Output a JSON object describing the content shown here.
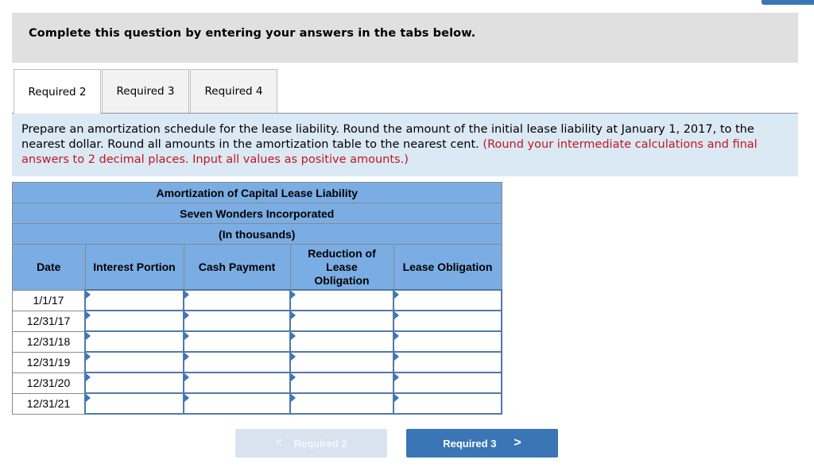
{
  "instructions": "Complete this question by entering your answers in the tabs below.",
  "tabs": [
    {
      "label": "Required 2",
      "active": true
    },
    {
      "label": "Required 3",
      "active": false
    },
    {
      "label": "Required 4",
      "active": false
    }
  ],
  "prompt": {
    "text": "Prepare an amortization schedule for the lease liability. Round the amount of the initial lease liability at January 1, 2017, to the nearest dollar. Round all amounts in the amortization table to the nearest cent. ",
    "note": "(Round your intermediate calculations and final answers to 2 decimal places. Input all values as positive amounts.)"
  },
  "table": {
    "title": "Amortization of Capital Lease Liability",
    "company": "Seven Wonders Incorporated",
    "units": "(In thousands)",
    "columns": [
      "Date",
      "Interest Portion",
      "Cash Payment",
      "Reduction of Lease Obligation",
      "Lease Obligation"
    ],
    "rows": [
      {
        "date": "1/1/17",
        "interest": "",
        "cash": "",
        "reduction": "",
        "obligation": ""
      },
      {
        "date": "12/31/17",
        "interest": "",
        "cash": "",
        "reduction": "",
        "obligation": ""
      },
      {
        "date": "12/31/18",
        "interest": "",
        "cash": "",
        "reduction": "",
        "obligation": ""
      },
      {
        "date": "12/31/19",
        "interest": "",
        "cash": "",
        "reduction": "",
        "obligation": ""
      },
      {
        "date": "12/31/20",
        "interest": "",
        "cash": "",
        "reduction": "",
        "obligation": ""
      },
      {
        "date": "12/31/21",
        "interest": "",
        "cash": "",
        "reduction": "",
        "obligation": ""
      }
    ]
  },
  "nav": {
    "prev_label": "Required 2",
    "prev_icon": "chevron-left-icon",
    "prev_disabled": true,
    "next_label": "Required 3",
    "next_icon": "chevron-right-icon"
  },
  "colors": {
    "header_blue": "#7aade3",
    "next_button": "#3a76b6",
    "prev_button_disabled": "#d9e3ef",
    "note_red": "#c0171f",
    "prompt_bg": "#dbe9f5",
    "banner_bg": "#e0e0e0"
  }
}
